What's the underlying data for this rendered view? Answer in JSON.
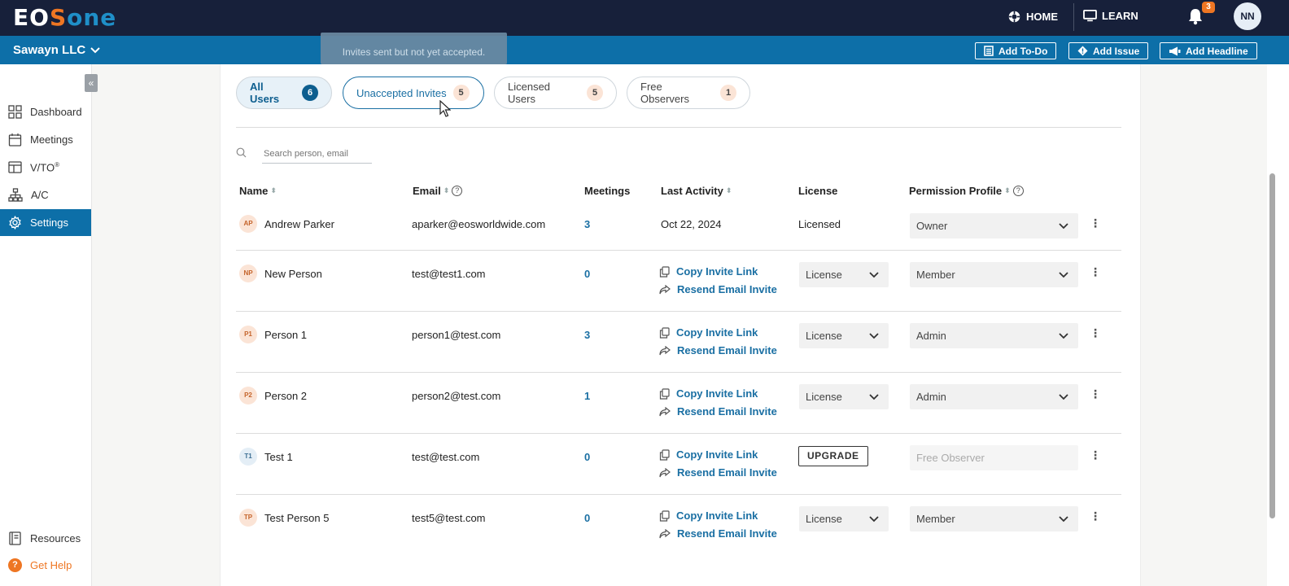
{
  "topbar": {
    "logo": {
      "part1": "E",
      "part2": "O",
      "part3": "S",
      "part4": "one"
    },
    "home_label": "HOME",
    "learn_label": "LEARN",
    "notifications_count": "3",
    "user_initials": "NN"
  },
  "orgbar": {
    "org_name": "Sawayn LLC",
    "tooltip": "Invites sent but not yet accepted.",
    "add_todo": "Add To-Do",
    "add_issue": "Add Issue",
    "add_headline": "Add Headline"
  },
  "sidebar": {
    "items": [
      {
        "label": "Dashboard",
        "icon": "grid-icon"
      },
      {
        "label": "Meetings",
        "icon": "calendar-icon"
      },
      {
        "label": "V/TO",
        "sup": "®",
        "icon": "layout-icon"
      },
      {
        "label": "A/C",
        "icon": "org-chart-icon"
      },
      {
        "label": "Settings",
        "icon": "gear-icon"
      }
    ],
    "resources": "Resources",
    "get_help": "Get Help"
  },
  "filters": [
    {
      "label": "All Users",
      "count": "6"
    },
    {
      "label": "Unaccepted Invites",
      "count": "5"
    },
    {
      "label": "Licensed Users",
      "count": "5"
    },
    {
      "label": "Free Observers",
      "count": "1"
    }
  ],
  "search": {
    "placeholder": "Search person, email"
  },
  "columns": {
    "name": "Name",
    "email": "Email",
    "meetings": "Meetings",
    "last_activity": "Last Activity",
    "license": "License",
    "permission": "Permission Profile"
  },
  "actions": {
    "copy": "Copy Invite Link",
    "resend": "Resend Email Invite",
    "upgrade": "UPGRADE"
  },
  "rows": [
    {
      "initials": "AP",
      "name": "Andrew Parker",
      "email": "aparker@eosworldwide.com",
      "meetings": "3",
      "last_activity": "Oct 22, 2024",
      "license": "Licensed",
      "permission": "Owner"
    },
    {
      "initials": "NP",
      "name": "New Person",
      "email": "test@test1.com",
      "meetings": "0",
      "license": "License",
      "permission": "Member"
    },
    {
      "initials": "P1",
      "name": "Person 1",
      "email": "person1@test.com",
      "meetings": "3",
      "license": "License",
      "permission": "Admin"
    },
    {
      "initials": "P2",
      "name": "Person 2",
      "email": "person2@test.com",
      "meetings": "1",
      "license": "License",
      "permission": "Admin"
    },
    {
      "initials": "T1",
      "name": "Test 1",
      "email": "test@test.com",
      "meetings": "0",
      "permission": "Free Observer"
    },
    {
      "initials": "TP",
      "name": "Test Person 5",
      "email": "test5@test.com",
      "meetings": "0",
      "license": "License",
      "permission": "Member"
    }
  ],
  "colors": {
    "navy": "#17203a",
    "blue": "#0d6fa8",
    "orange": "#ee7623",
    "link": "#1a6fa3"
  }
}
